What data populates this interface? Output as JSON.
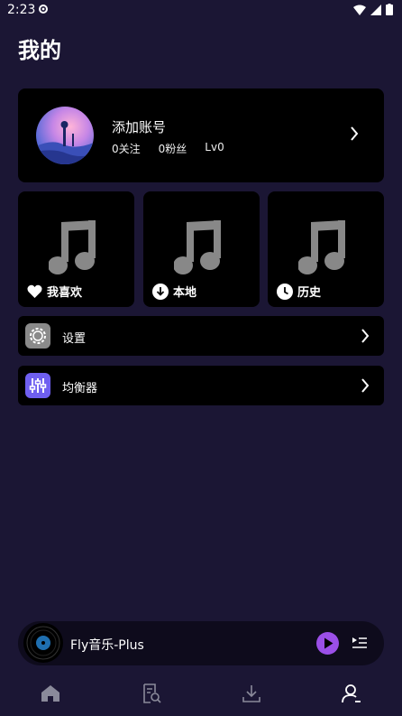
{
  "status_bar": {
    "time": "2:23"
  },
  "page": {
    "title": "我的"
  },
  "account": {
    "name": "添加账号",
    "following": "0关注",
    "fans": "0粉丝",
    "level": "Lv0"
  },
  "quick_cards": [
    {
      "label": "我喜欢",
      "icon": "heart-icon"
    },
    {
      "label": "本地",
      "icon": "download-circle-icon"
    },
    {
      "label": "历史",
      "icon": "clock-icon"
    }
  ],
  "menu": [
    {
      "label": "设置",
      "icon": "settings-gear-icon",
      "color": "#8a8a8a"
    },
    {
      "label": "均衡器",
      "icon": "equalizer-icon",
      "color": "#6f5ff0"
    }
  ],
  "player": {
    "title": "Fly音乐-Plus",
    "accent": "#9b4fe8"
  },
  "bottom_nav": [
    {
      "icon": "home-icon",
      "active": false
    },
    {
      "icon": "search-document-icon",
      "active": false
    },
    {
      "icon": "download-icon",
      "active": false
    },
    {
      "icon": "profile-icon",
      "active": true
    }
  ]
}
